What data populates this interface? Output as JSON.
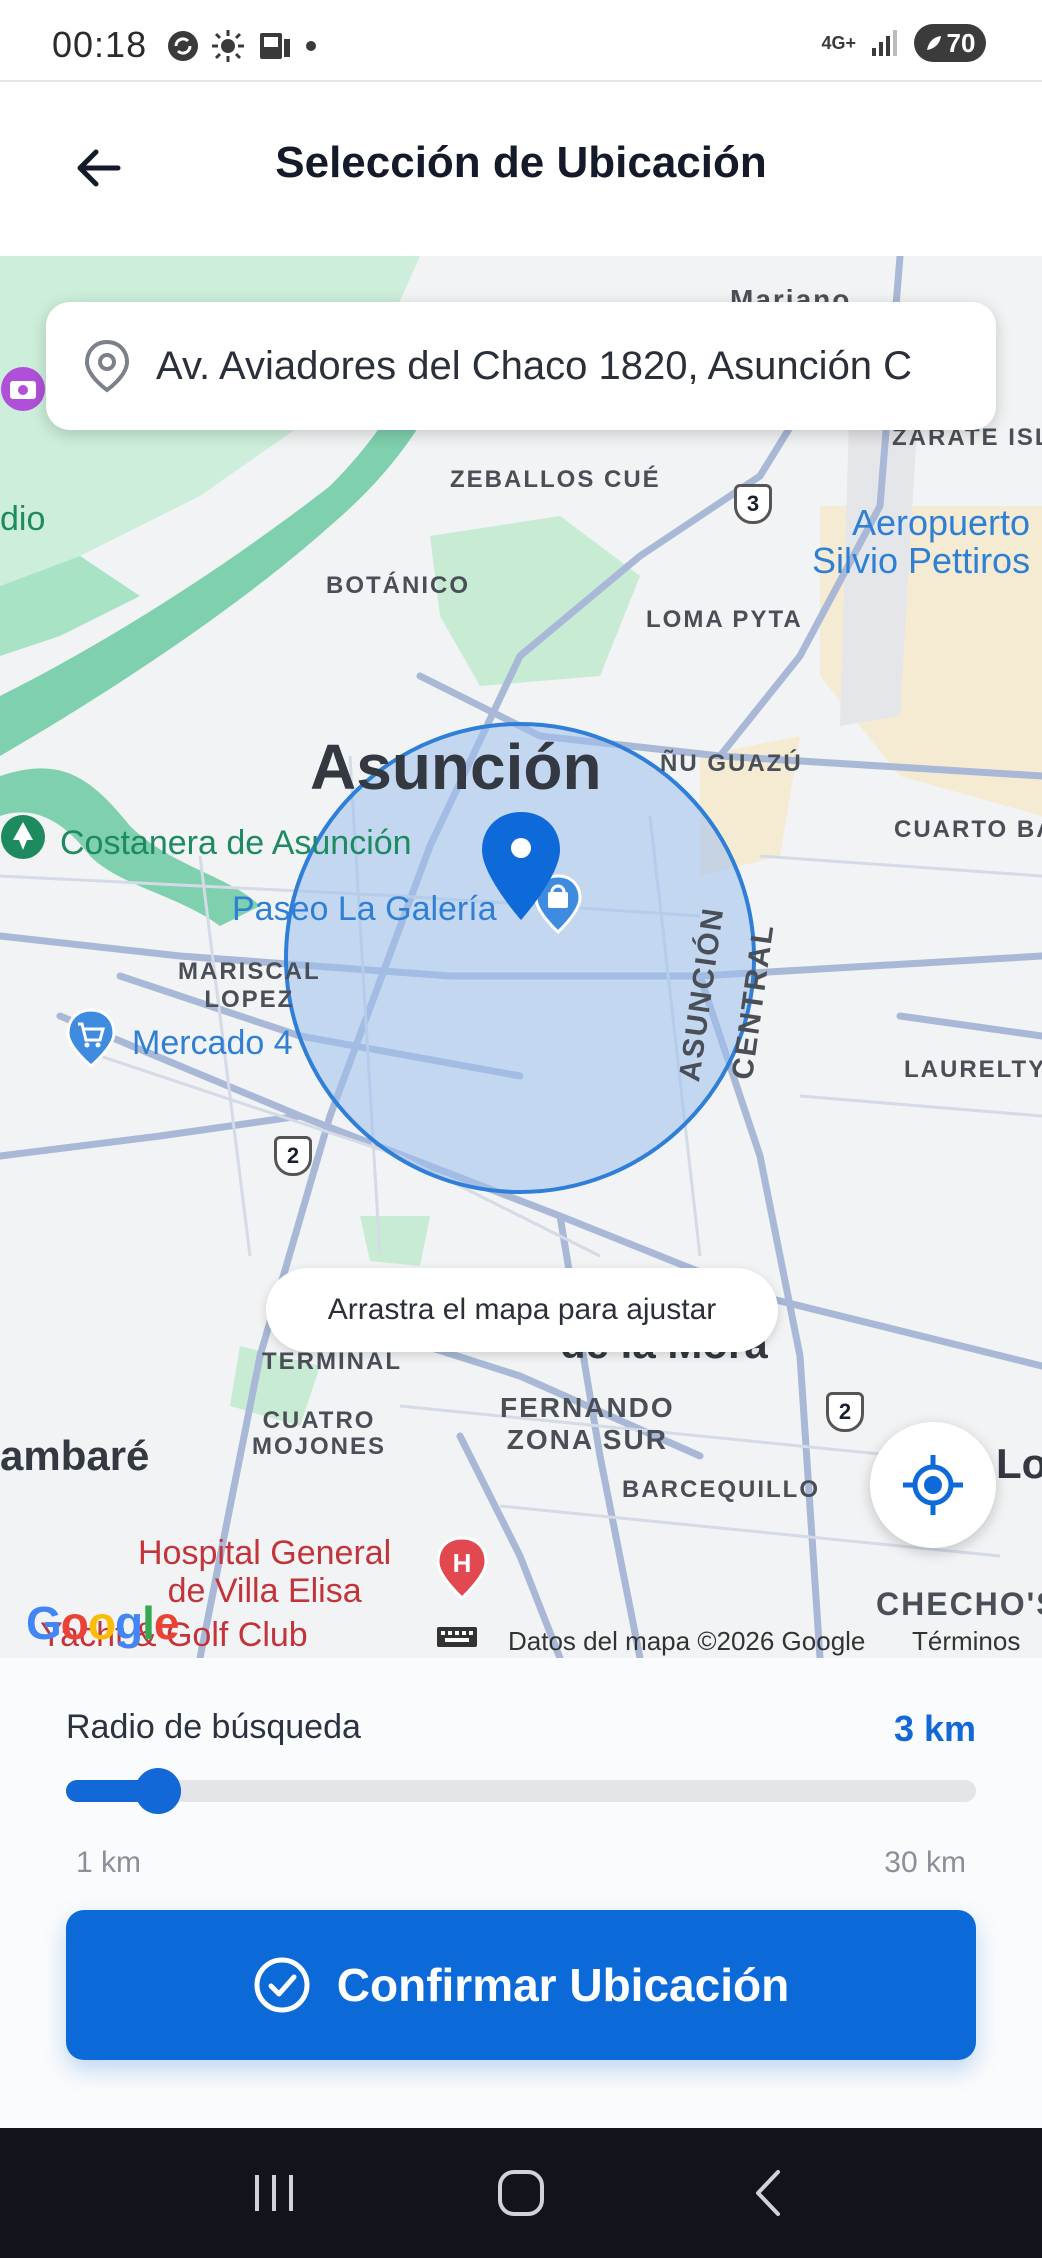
{
  "status_bar": {
    "time": "00:18",
    "network": "4G+",
    "battery": "70"
  },
  "header": {
    "title": "Selección de Ubicación"
  },
  "search": {
    "address": "Av. Aviadores del Chaco 1820, Asunción C"
  },
  "map": {
    "labels": {
      "mariano": "Mariano",
      "zarate": "ZARATE ISL",
      "zeballos": "ZEBALLOS CUÉ",
      "aeropuerto": "Aeropuerto\nSilvio Pettiros",
      "dio": "dio",
      "botanico": "BOTÁNICO",
      "loma_pyta": "LOMA PYTA",
      "asuncion": "Asunción",
      "nu_guazu": "ÑU GUAZÚ",
      "cuarto_ba": "CUARTO BA",
      "costanera": "Costanera de Asunción",
      "paseo": "Paseo La Galería",
      "mariscal": "MARISCAL\nLOPEZ",
      "mercado": "Mercado 4",
      "asuncion_central": "ASUNCIÓN\nCENTRAL",
      "laurelty": "LAURELTY",
      "terminal": "TERMINAL",
      "de_la_mora": "de la Mora",
      "fernando": "FERNANDO\nZONA SUR",
      "cuatro_mojones": "CUATRO\nMOJONES",
      "lambare": "ambaré",
      "barcequillo": "BARCEQUILLO",
      "lo": "Lo",
      "hospital": "Hospital General\nde Villa Elisa",
      "yacht": "Yacht & Golf Club",
      "checho": "CHECHO'S",
      "route2a": "2",
      "route2b": "2",
      "route3": "3"
    },
    "hint": "Arrastra el mapa para ajustar",
    "google": "Google",
    "attribution": "Datos del mapa ©2026 Google",
    "terms": "Términos",
    "colors": {
      "water": "#7ed0ae",
      "park": "#c8ebd3",
      "road": "#a8b8d6",
      "circle_fill": "#9cc0ef",
      "circle_stroke": "#2f7fd9",
      "pin": "#0d6ad8"
    }
  },
  "radius": {
    "label": "Radio de búsqueda",
    "value_text": "3 km",
    "min_label": "1 km",
    "max_label": "30 km",
    "min": 1,
    "max": 30,
    "value": 3
  },
  "confirm": {
    "label": "Confirmar Ubicación"
  },
  "icons": {
    "back": "arrow-left-icon",
    "pin": "location-pin-icon",
    "locate": "my-location-icon",
    "check": "check-circle-icon",
    "keyboard": "keyboard-icon",
    "nav_recents": "recents-icon",
    "nav_home": "home-icon",
    "nav_back": "nav-back-icon"
  }
}
